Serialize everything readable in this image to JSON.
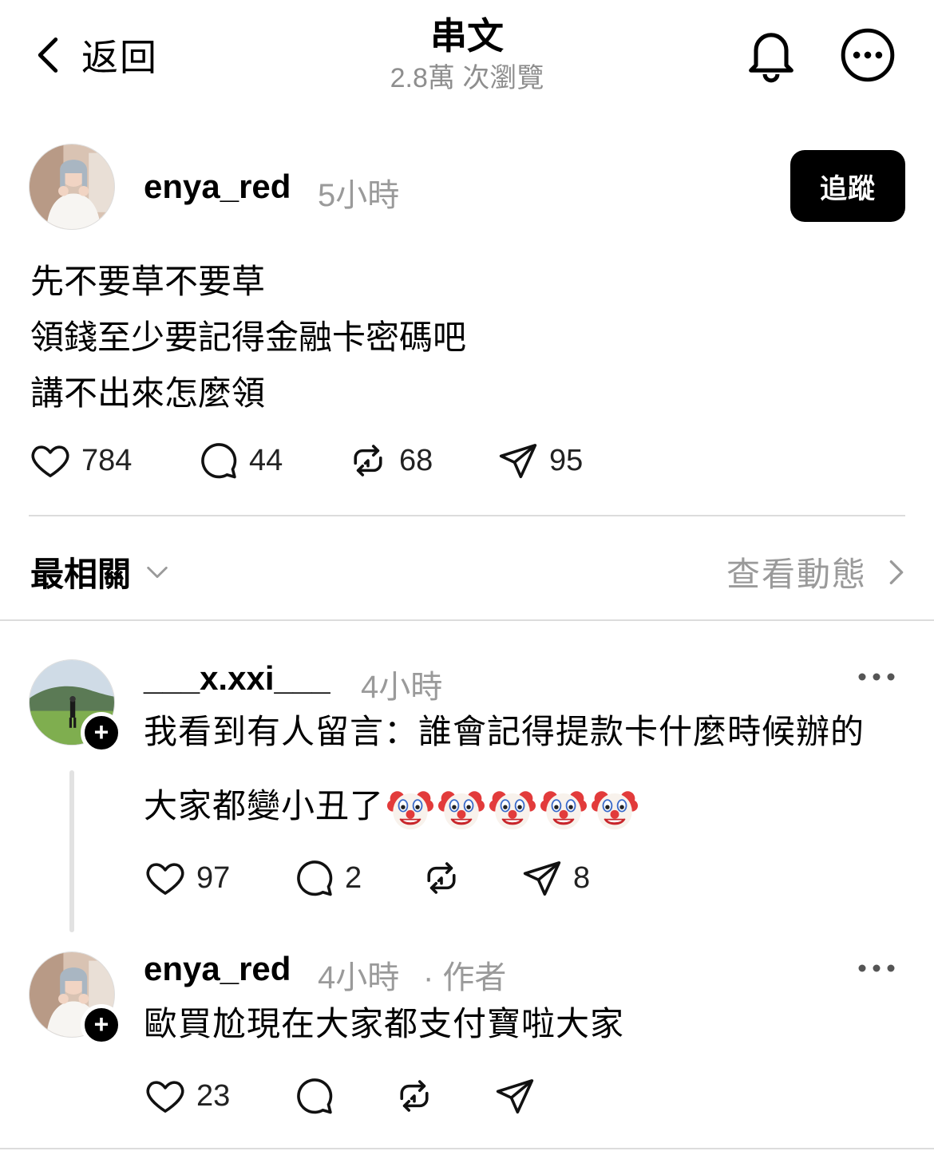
{
  "header": {
    "back_label": "返回",
    "title": "串文",
    "views": "2.8萬 次瀏覽",
    "bell_icon": "bell-icon",
    "more_icon": "more-circle-icon"
  },
  "post": {
    "username": "enya_red",
    "time": "5小時",
    "follow_label": "追蹤",
    "lines": [
      "先不要草不要草",
      "領錢至少要記得金融卡密碼吧",
      "講不出來怎麼領"
    ],
    "likes": "784",
    "comments": "44",
    "reposts": "68",
    "shares": "95"
  },
  "sort": {
    "label": "最相關",
    "activity_label": "查看動態"
  },
  "replies": [
    {
      "username": "___x.xxi___",
      "time": "4小時",
      "line1": "我看到有人留言：誰會記得提款卡什麼時候辦的",
      "line2": "大家都變小丑了",
      "emoji": "clown-face",
      "likes": "97",
      "comments": "2",
      "reposts": "",
      "shares": "8"
    },
    {
      "username": "enya_red",
      "time": "4小時",
      "author_tag": "· 作者",
      "line1": "歐買尬現在大家都支付寶啦大家",
      "likes": "23",
      "comments": "",
      "reposts": "",
      "shares": ""
    }
  ],
  "colors": {
    "primary": "#000000",
    "muted": "#9a9a9a",
    "divider": "#dcdcdc"
  }
}
